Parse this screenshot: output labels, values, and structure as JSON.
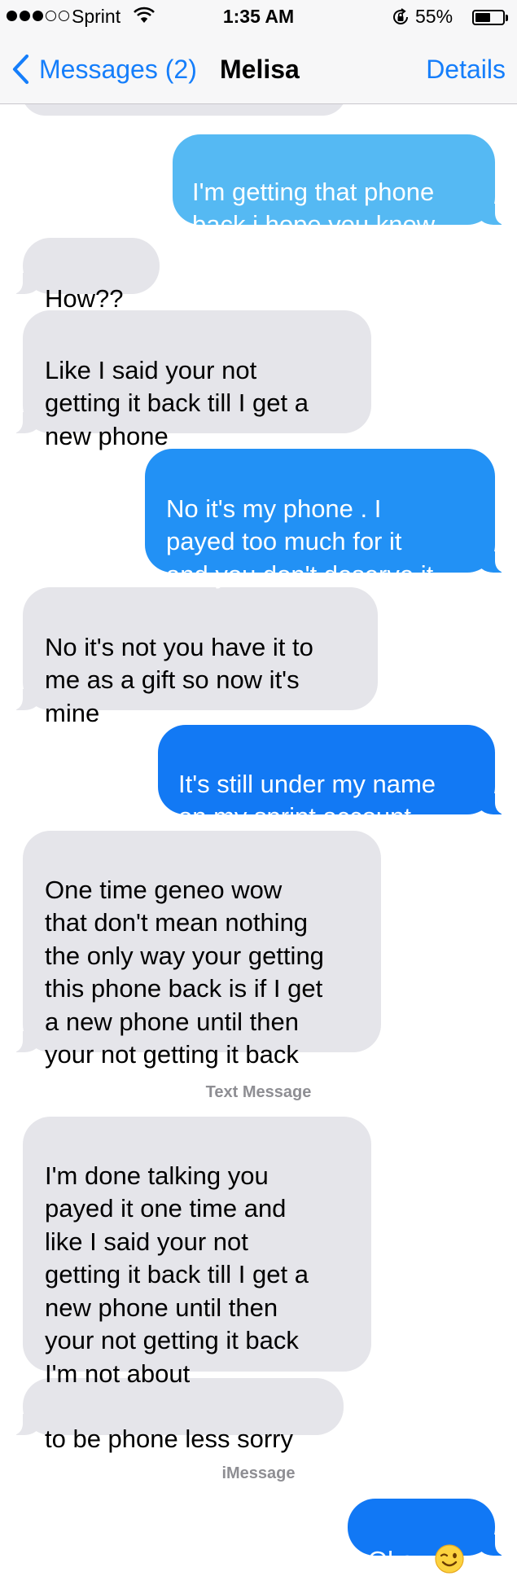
{
  "status_bar": {
    "carrier": "Sprint",
    "time": "1:35 AM",
    "battery_percent": "55%",
    "battery_level": 0.55,
    "signal_bars_filled": 3,
    "signal_bars_total": 5
  },
  "nav": {
    "back_label": "Messages (2)",
    "title": "Melisa",
    "details_label": "Details"
  },
  "colors": {
    "ios_blue": "#157efb",
    "incoming_bubble": "#e5e5ea",
    "outgoing_bubble_light": "#55b9f3",
    "outgoing_bubble_dark": "#1178f5",
    "service_label": "#8e8e93"
  },
  "messages": [
    {
      "direction": "outgoing",
      "text": "I'm getting that phone\nback i hope you know"
    },
    {
      "direction": "incoming",
      "text": "How??"
    },
    {
      "direction": "incoming",
      "text": "Like I said your not\ngetting it back till I get a\nnew phone"
    },
    {
      "direction": "outgoing",
      "text": "No it's my phone . I\npayed too much for it\nand you don't deserve it"
    },
    {
      "direction": "incoming",
      "text": "No it's not you have it to\nme as a gift so now it's\nmine"
    },
    {
      "direction": "outgoing",
      "text": "It's still under my name\non my sprint account"
    },
    {
      "direction": "incoming",
      "text": "One time geneo wow\nthat don't mean nothing\nthe only way your getting\nthis phone back is if I get\na new phone until then\nyour not getting it back"
    },
    {
      "direction": "incoming",
      "text": "I'm done talking you\npayed it one time and\nlike I said your not\ngetting it back till I get a\nnew phone until then\nyour not getting it back\nI'm not about"
    },
    {
      "direction": "incoming",
      "text": "to be phone less sorry"
    },
    {
      "direction": "outgoing",
      "text": "Okay",
      "emoji": "winking-face"
    }
  ],
  "service_labels": [
    "Text Message",
    "iMessage"
  ]
}
